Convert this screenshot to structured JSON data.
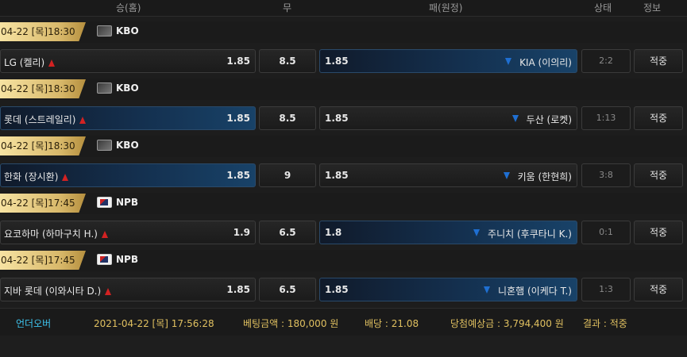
{
  "header": {
    "home": "승(홈)",
    "draw": "무",
    "away": "패(원정)",
    "state": "상태",
    "info": "정보"
  },
  "matches": [
    {
      "date": "04-22 [목]18:30",
      "league": "KBO",
      "league_icon": "kbo-logo-icon",
      "home": "LG (켈리)",
      "home_odds": "1.85",
      "home_trend": "up-arrow-icon",
      "draw": "8.5",
      "away_odds": "1.85",
      "away": "KIA (이의리)",
      "away_trend": "down-arrow-icon",
      "selected": "away",
      "score": "2:2",
      "info": "적중"
    },
    {
      "date": "04-22 [목]18:30",
      "league": "KBO",
      "league_icon": "kbo-logo-icon",
      "home": "롯데 (스트레일리)",
      "home_odds": "1.85",
      "home_trend": "up-arrow-icon",
      "draw": "8.5",
      "away_odds": "1.85",
      "away": "두산 (로켓)",
      "away_trend": "down-arrow-icon",
      "selected": "home",
      "score": "1:13",
      "info": "적중"
    },
    {
      "date": "04-22 [목]18:30",
      "league": "KBO",
      "league_icon": "kbo-logo-icon",
      "home": "한화 (장시환)",
      "home_odds": "1.85",
      "home_trend": "up-arrow-icon",
      "draw": "9",
      "away_odds": "1.85",
      "away": "키움 (한현희)",
      "away_trend": "down-arrow-icon",
      "selected": "home",
      "score": "3:8",
      "info": "적중"
    },
    {
      "date": "04-22 [목]17:45",
      "league": "NPB",
      "league_icon": "npb-logo-icon",
      "home": "요코하마 (하마구치 H.)",
      "home_odds": "1.9",
      "home_trend": "up-arrow-icon",
      "draw": "6.5",
      "away_odds": "1.8",
      "away": "주니치 (후쿠타니 K.)",
      "away_trend": "down-arrow-icon",
      "selected": "away",
      "score": "0:1",
      "info": "적중"
    },
    {
      "date": "04-22 [목]17:45",
      "league": "NPB",
      "league_icon": "npb-logo-icon",
      "home": "지바 롯데 (이와시타 D.)",
      "home_odds": "1.85",
      "home_trend": "up-arrow-icon",
      "draw": "6.5",
      "away_odds": "1.85",
      "away": "니혼햄 (이케다 T.)",
      "away_trend": "down-arrow-icon",
      "selected": "away",
      "score": "1:3",
      "info": "적중"
    }
  ],
  "footer": {
    "type": "언더오버",
    "datetime": "2021-04-22 [목] 17:56:28",
    "bet_amount": "베팅금액 : 180,000 원",
    "odds": "배당 : 21.08",
    "expected": "당첨예상금 : 3,794,400 원",
    "result": "결과 : 적중"
  },
  "colors": {
    "accent_gold": "#d8b86a",
    "selected_blue": "#184268",
    "up_red": "#d22222",
    "down_blue": "#1f6fd2",
    "footer_label": "#3ec4ee",
    "footer_value": "#e0c060"
  }
}
